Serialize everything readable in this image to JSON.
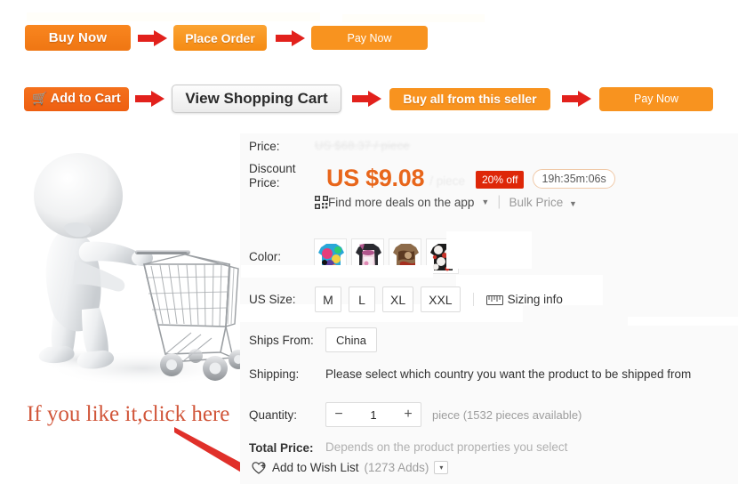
{
  "flow": {
    "row1": [
      {
        "id": "buy-now",
        "label": "Buy Now"
      },
      {
        "id": "arrow-1",
        "label": ""
      },
      {
        "id": "place-order",
        "label": "Place Order"
      },
      {
        "id": "arrow-2",
        "label": ""
      },
      {
        "id": "pay-now-1",
        "label": "Pay Now"
      }
    ],
    "row2": [
      {
        "id": "add-to-cart",
        "label": "Add to Cart",
        "icon": "shopping-cart-icon"
      },
      {
        "id": "arrow-3",
        "label": ""
      },
      {
        "id": "view-shopping-cart",
        "label": "View Shopping Cart"
      },
      {
        "id": "arrow-4",
        "label": ""
      },
      {
        "id": "buy-all-from-seller",
        "label": "Buy all from this seller"
      },
      {
        "id": "arrow-5",
        "label": ""
      },
      {
        "id": "pay-now-2",
        "label": "Pay Now"
      }
    ]
  },
  "annotation": {
    "text": "If you like it,click here",
    "color": "#d1563a",
    "arrow_icon": "red-pointer-arrow-icon"
  },
  "product": {
    "price_label": "Price:",
    "original_price": "US $68.37 / piece",
    "discount_price_label": "Discount Price:",
    "discount_price": "US $9.08",
    "unit": "/ piece",
    "discount_badge": "20% off",
    "countdown": "19h:35m:06s",
    "app_deal_label": "Find more deals on the app",
    "bulk_price_label": "Bulk Price",
    "color_label": "Color:",
    "color_swatches": [
      {
        "name": "swatch-skull-multicolor",
        "c1": "#2aa7d8",
        "c2": "#e53d7a",
        "c3": "#f4d03f",
        "c4": "#5d3fa0"
      },
      {
        "name": "swatch-pink-white",
        "c1": "#f2d5e2",
        "c2": "#b0558c",
        "c3": "#2a2a30",
        "c4": "#f7eef3"
      },
      {
        "name": "swatch-brown-tan",
        "c1": "#8d6b4a",
        "c2": "#5c3a22",
        "c3": "#c2a07a",
        "c4": "#a52f1f"
      },
      {
        "name": "swatch-black-white-red",
        "c1": "#f2efec",
        "c2": "#1b1b1b",
        "c3": "#c8342b",
        "c4": "#e8e2dc"
      }
    ],
    "size_label": "US Size:",
    "sizes": [
      "M",
      "L",
      "XL",
      "XXL"
    ],
    "sizing_info_label": "Sizing info",
    "ships_from_label": "Ships From:",
    "ships_from_value": "China",
    "shipping_label": "Shipping:",
    "shipping_note": "Please select which country you want the product to be shipped from",
    "quantity_label": "Quantity:",
    "quantity_minus": "−",
    "quantity_value": "1",
    "quantity_plus": "+",
    "quantity_note": "piece (1532 pieces available)",
    "total_price_label": "Total Price:",
    "total_price_note": "Depends on the product properties you select",
    "wish_list_label": "Add to Wish List",
    "wish_list_count": "(1273 Adds)",
    "wish_list_caret": "▾"
  },
  "colors": {
    "orange": "#f8931f",
    "orange_dark": "#ee5f11",
    "red_arrow": "#e2211c",
    "price_orange": "#e8661b",
    "badge_red": "#de2708",
    "panel_bg": "#fafafa"
  }
}
